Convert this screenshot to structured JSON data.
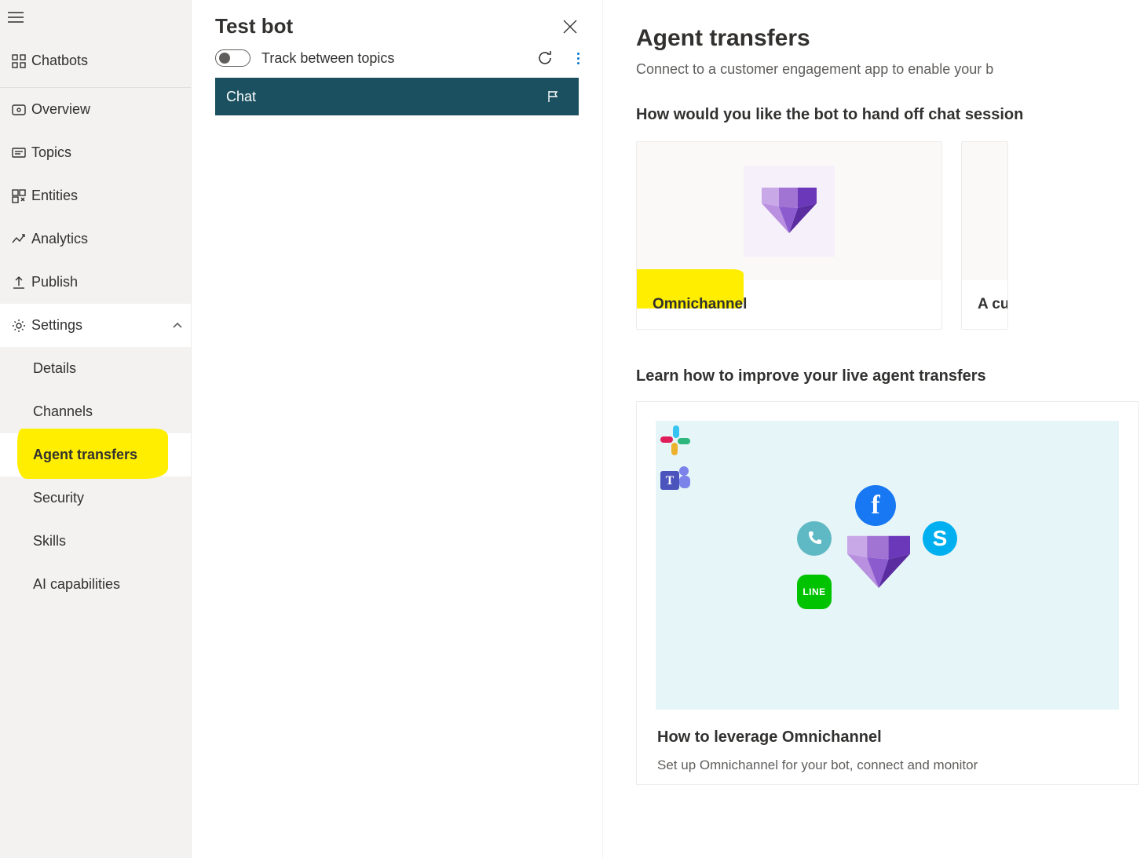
{
  "sidebar": {
    "top": {
      "label": "Chatbots"
    },
    "items": [
      {
        "icon": "overview",
        "label": "Overview"
      },
      {
        "icon": "topics",
        "label": "Topics"
      },
      {
        "icon": "entities",
        "label": "Entities"
      },
      {
        "icon": "analytics",
        "label": "Analytics"
      },
      {
        "icon": "publish",
        "label": "Publish"
      }
    ],
    "settings": {
      "label": "Settings",
      "expanded": true,
      "children": [
        {
          "label": "Details"
        },
        {
          "label": "Channels"
        },
        {
          "label": "Agent transfers",
          "active": true,
          "highlighted": true
        },
        {
          "label": "Security"
        },
        {
          "label": "Skills"
        },
        {
          "label": "AI capabilities"
        }
      ]
    }
  },
  "testbot": {
    "title": "Test bot",
    "track_label": "Track between topics",
    "track_on": false,
    "chat_tab": "Chat"
  },
  "main": {
    "title": "Agent transfers",
    "subtitle": "Connect to a customer engagement app to enable your b",
    "question": "How would you like the bot to hand off chat session",
    "options": [
      {
        "label": "Omnichannel",
        "highlighted": true
      },
      {
        "label": "A cus"
      }
    ],
    "learn_heading": "Learn how to improve your live agent transfers",
    "learn_card": {
      "title": "How to leverage Omnichannel",
      "desc": "Set up Omnichannel for your bot, connect and monitor"
    }
  },
  "icons": {
    "line_text": "LINE",
    "skype_text": "S",
    "fb_text": "f"
  }
}
